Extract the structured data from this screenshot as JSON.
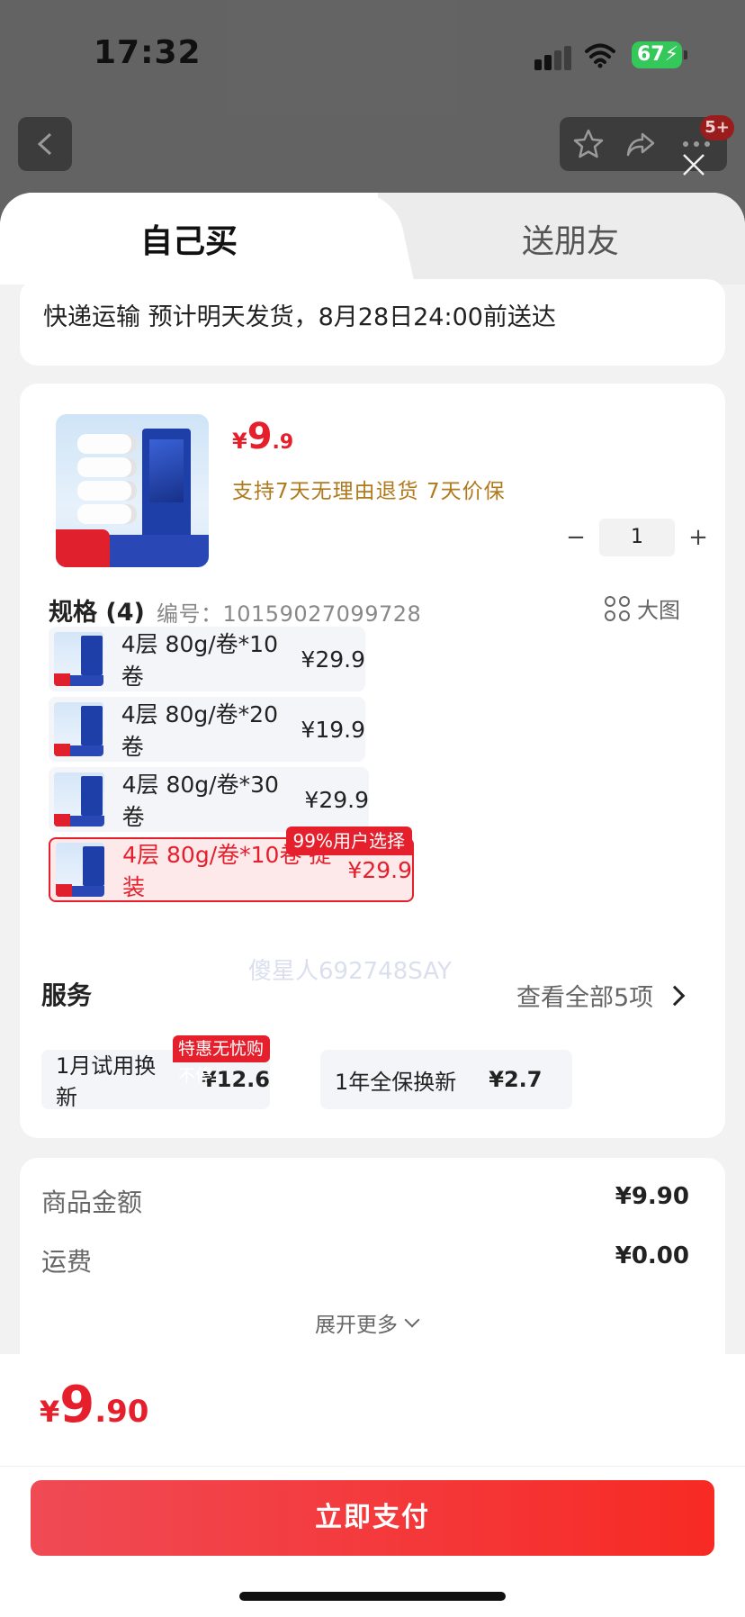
{
  "status_bar": {
    "time": "17:32",
    "battery": "67"
  },
  "background": {
    "badge": "5+"
  },
  "tabs": [
    {
      "label": "自己买",
      "active": true
    },
    {
      "label": "送朋友",
      "active": false
    }
  ],
  "delivery": {
    "text": "快递运输 预计明天发货，8月28日24:00前送达"
  },
  "product": {
    "price_currency": "¥",
    "price_int": "9",
    "price_dec": ".9",
    "guarantee": "支持7天无理由退货  7天价保",
    "quantity": "1",
    "qty_minus": "−",
    "qty_plus": "+",
    "thumb_text": {
      "top": "维达超韧无芯卷纸4层80克10卷",
      "corner_line1": "单提到手",
      "corner_line2": "10卷",
      "bottom": "厚实4层 韧性大长卷"
    }
  },
  "spec": {
    "title": "规格 (4)",
    "code": "编号：10159027099728",
    "big_image": "大图",
    "options": [
      {
        "label": "4层 80g/卷*10卷",
        "price": "¥29.9",
        "selected": false,
        "badge": ""
      },
      {
        "label": "4层 80g/卷*20卷",
        "price": "¥19.9",
        "selected": false,
        "badge": ""
      },
      {
        "label": "4层 80g/卷*30卷",
        "price": "¥29.9",
        "selected": false,
        "badge": ""
      },
      {
        "label": "4层 80g/卷*10卷 提装",
        "price": "¥29.9",
        "selected": true,
        "badge": "99%用户选择"
      }
    ]
  },
  "service": {
    "title": "服务",
    "view_all": "查看全部5项",
    "items": [
      {
        "label": "1月试用换新",
        "price": "¥12.6",
        "badge": "特惠无忧购不停"
      },
      {
        "label": "1年全保换新",
        "price": "¥2.7",
        "badge": ""
      }
    ]
  },
  "fees": [
    {
      "label": "商品金额",
      "value": "¥9.90"
    },
    {
      "label": "运费",
      "value": "¥0.00"
    }
  ],
  "expand_more": "展开更多",
  "total": {
    "currency": "¥",
    "int": "9",
    "dec": ".90"
  },
  "pay_button": "立即支付",
  "watermark": "傻星人692748SAY",
  "colors": {
    "accent": "#e5202c",
    "guarantee": "#b07a1c",
    "battery": "#34c759"
  }
}
